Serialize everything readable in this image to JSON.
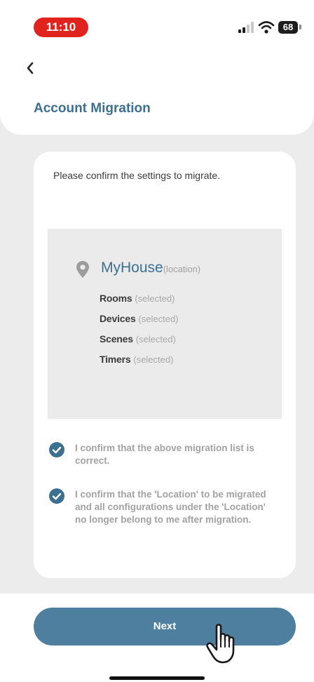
{
  "status_bar": {
    "time": "11:10",
    "battery": "68",
    "icons": [
      "signal-icon",
      "wifi-icon",
      "battery-icon"
    ]
  },
  "header": {
    "back_icon": "chevron-left-icon",
    "title": "Account Migration"
  },
  "card": {
    "instruction": "Please confirm the settings to migrate.",
    "location": {
      "icon": "pin-icon",
      "name": "MyHouse",
      "tag": "(location)"
    },
    "items": [
      {
        "name": "Rooms",
        "tag": "(selected)"
      },
      {
        "name": "Devices",
        "tag": "(selected)"
      },
      {
        "name": "Scenes",
        "tag": "(selected)"
      },
      {
        "name": "Timers",
        "tag": "(selected)"
      }
    ],
    "confirmations": [
      {
        "checked": true,
        "text": "I confirm that the above migration list is correct."
      },
      {
        "checked": true,
        "text": "I confirm that the 'Location' to be migrated and all configurations under the 'Location' no longer belong to me after migration."
      }
    ]
  },
  "footer": {
    "next_label": "Next"
  },
  "colors": {
    "accent": "#3d6f91",
    "button": "#4e7f9f",
    "time_pill": "#e0231d",
    "background": "#ececec"
  }
}
